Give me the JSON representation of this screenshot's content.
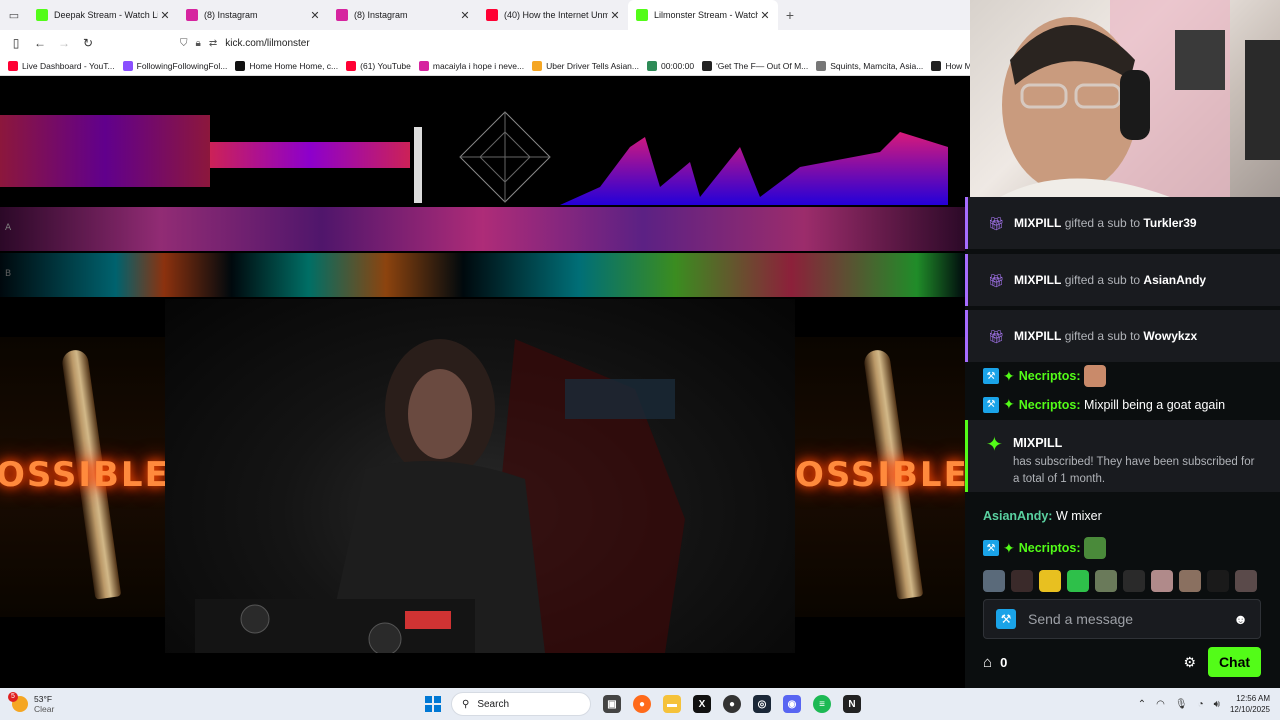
{
  "browser": {
    "tabs": [
      {
        "title": "Deepak Stream - Watch Live on",
        "favicon": "kick-icon",
        "color": "#53fc18",
        "active": false
      },
      {
        "title": "(8) Instagram",
        "favicon": "instagram-icon",
        "color": "#d6249f",
        "active": false
      },
      {
        "title": "(8) Instagram",
        "favicon": "instagram-icon",
        "color": "#d6249f",
        "active": false
      },
      {
        "title": "(40) How the Internet Unmaske",
        "favicon": "youtube-icon",
        "color": "#ff0033",
        "active": false
      },
      {
        "title": "Lilmonster Stream - Watch",
        "favicon": "kick-icon",
        "color": "#53fc18",
        "active": true
      }
    ],
    "url": "kick.com/lilmonster",
    "bookmarks": [
      {
        "label": "Live Dashboard - YouT...",
        "color": "#ff0033"
      },
      {
        "label": "FollowingFollowingFol...",
        "color": "#8a4fff"
      },
      {
        "label": "Home Home Home, c...",
        "color": "#111111"
      },
      {
        "label": "(61) YouTube",
        "color": "#ff0033"
      },
      {
        "label": "macaiyla i hope i neve...",
        "color": "#d6249f"
      },
      {
        "label": "Uber Driver Tells Asian...",
        "color": "#f5a623"
      },
      {
        "label": "00:00:00",
        "color": "#2e8b57"
      },
      {
        "label": "'Get The F— Out Of M...",
        "color": "#222222"
      },
      {
        "label": "Squints, Mamcita, Asia...",
        "color": "#777777"
      },
      {
        "label": "How Much Money",
        "color": "#222222"
      }
    ]
  },
  "stream": {
    "overlay_text": "OSSIBLE V",
    "lane_a": "A",
    "lane_b": "B"
  },
  "chat": {
    "gifts": [
      {
        "gifter": "MIXPILL",
        "action": "gifted a sub to",
        "recipient": "Turkler39"
      },
      {
        "gifter": "MIXPILL",
        "action": "gifted a sub to",
        "recipient": "AsianAndy"
      },
      {
        "gifter": "MIXPILL",
        "action": "gifted a sub to",
        "recipient": "Wowykzx"
      }
    ],
    "messages": [
      {
        "user": "Necriptos:",
        "text": ""
      },
      {
        "user": "Necriptos:",
        "text": "Mixpill being a goat again"
      }
    ],
    "subscription": {
      "user": "MIXPILL",
      "text": "has subscribed! They have been subscribed for a total of 1 month."
    },
    "message3": {
      "user": "AsianAndy:",
      "text": "W mixer"
    },
    "message4": {
      "user": "Necriptos:",
      "text": ""
    },
    "input_placeholder": "Send a message",
    "points": "0",
    "chat_button": "Chat"
  },
  "taskbar": {
    "weather_temp": "53°F",
    "weather_desc": "Clear",
    "weather_alert": "5",
    "search_label": "Search",
    "time": "12:56 AM",
    "date": "12/10/2025"
  }
}
